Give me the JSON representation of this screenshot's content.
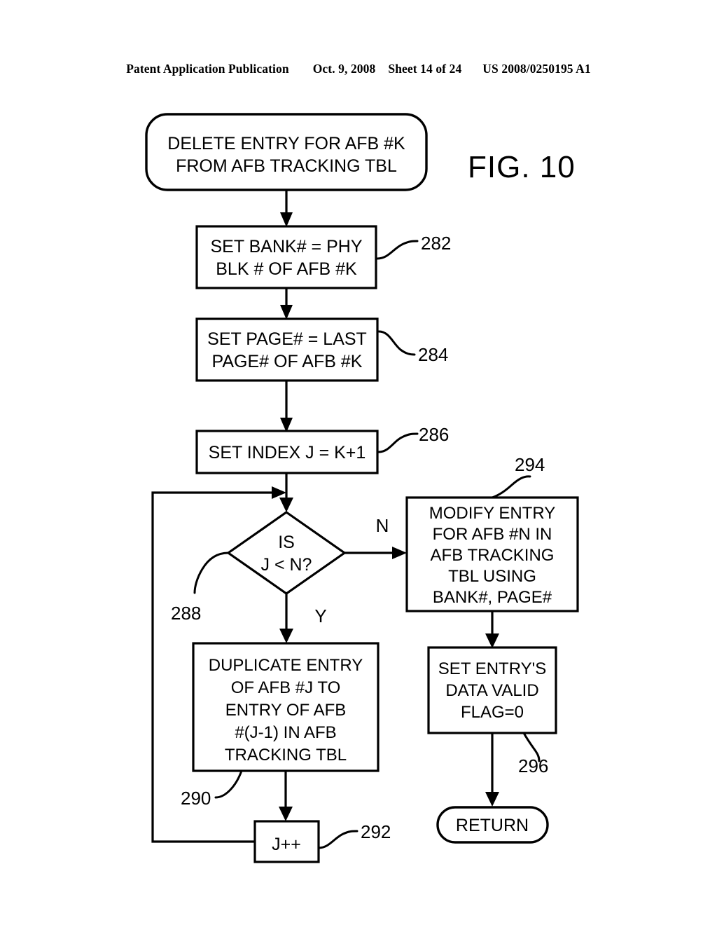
{
  "header": {
    "publication": "Patent Application Publication",
    "date": "Oct. 9, 2008",
    "sheet": "Sheet 14 of 24",
    "patent_number": "US 2008/0250195 A1"
  },
  "figure": {
    "label": "FIG. 10",
    "nodes": {
      "start": {
        "shape": "terminal",
        "lines": [
          "DELETE ENTRY FOR AFB #K",
          "FROM AFB TRACKING TBL"
        ]
      },
      "set_bank": {
        "shape": "process",
        "ref": "282",
        "lines": [
          "SET BANK# = PHY",
          "BLK # OF AFB #K"
        ]
      },
      "set_page": {
        "shape": "process",
        "ref": "284",
        "lines": [
          "SET PAGE# = LAST",
          "PAGE# OF AFB #K"
        ]
      },
      "set_index": {
        "shape": "process",
        "ref": "286",
        "lines": [
          "SET INDEX J = K+1"
        ]
      },
      "decision": {
        "shape": "decision",
        "ref": "288",
        "lines": [
          "IS",
          "J < N?"
        ],
        "branch_no": "N",
        "branch_yes": "Y"
      },
      "duplicate": {
        "shape": "process",
        "ref": "290",
        "lines": [
          "DUPLICATE ENTRY",
          "OF AFB #J TO",
          "ENTRY OF AFB",
          "#(J-1) IN AFB",
          "TRACKING TBL"
        ]
      },
      "increment": {
        "shape": "process",
        "ref": "292",
        "lines": [
          "J++"
        ]
      },
      "modify": {
        "shape": "process",
        "ref": "294",
        "lines": [
          "MODIFY ENTRY",
          "FOR AFB #N IN",
          "AFB TRACKING",
          "TBL  USING",
          "BANK#, PAGE#"
        ]
      },
      "set_flag": {
        "shape": "process",
        "ref": "296",
        "lines": [
          "SET ENTRY'S",
          "DATA VALID",
          "FLAG=0"
        ]
      },
      "return": {
        "shape": "terminal",
        "lines": [
          "RETURN"
        ]
      }
    }
  },
  "colors": {
    "ink": "#000000",
    "paper": "#ffffff"
  }
}
